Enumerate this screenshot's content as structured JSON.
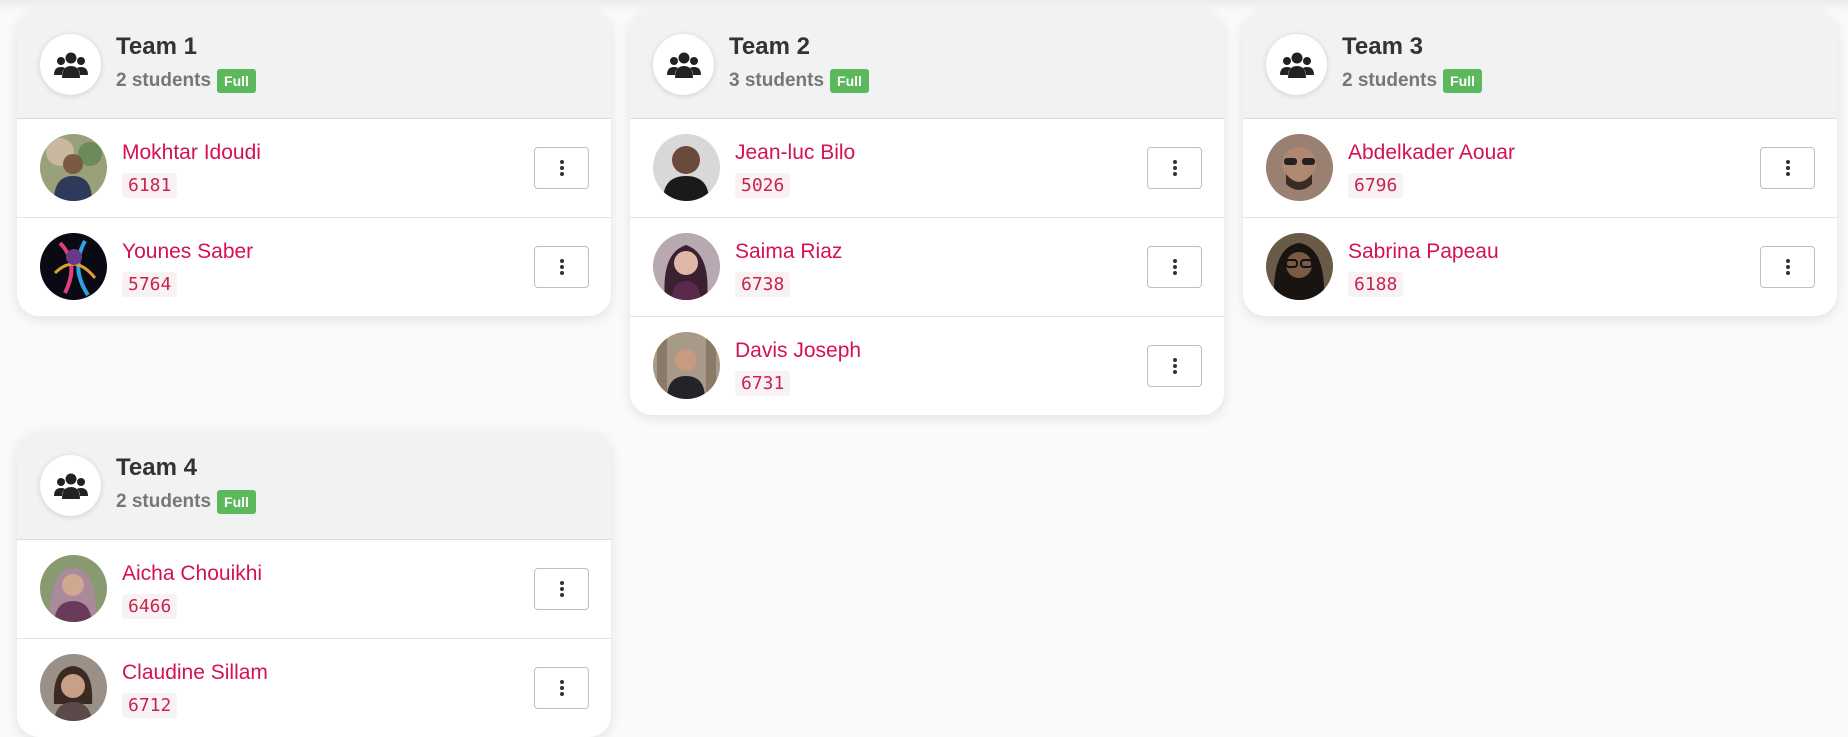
{
  "teams": [
    {
      "name": "Team 1",
      "count": "2 students",
      "badge": "Full",
      "members": [
        {
          "name": "Mokhtar Idoudi",
          "id": "6181",
          "avatar_color": "#8a7a5c"
        },
        {
          "name": "Younes Saber",
          "id": "5764",
          "avatar_color": "#2a1a3a"
        }
      ]
    },
    {
      "name": "Team 2",
      "count": "3 students",
      "badge": "Full",
      "members": [
        {
          "name": "Jean-luc Bilo",
          "id": "5026",
          "avatar_color": "#3a3a3a"
        },
        {
          "name": "Saima Riaz",
          "id": "6738",
          "avatar_color": "#6a4a5a"
        },
        {
          "name": "Davis Joseph",
          "id": "6731",
          "avatar_color": "#7a6a5a"
        }
      ]
    },
    {
      "name": "Team 3",
      "count": "2 students",
      "badge": "Full",
      "members": [
        {
          "name": "Abdelkader Aouar",
          "id": "6796",
          "avatar_color": "#6a4a3a"
        },
        {
          "name": "Sabrina Papeau",
          "id": "6188",
          "avatar_color": "#4a3a2a"
        }
      ]
    },
    {
      "name": "Team 4",
      "count": "2 students",
      "badge": "Full",
      "members": [
        {
          "name": "Aicha Chouikhi",
          "id": "6466",
          "avatar_color": "#8a6a7a"
        },
        {
          "name": "Claudine Sillam",
          "id": "6712",
          "avatar_color": "#7a6a6a"
        }
      ]
    }
  ],
  "icons": {
    "team": "users-icon",
    "menu": "more-vertical-icon"
  },
  "colors": {
    "member_name": "#d4124e",
    "badge": "#5cb85c",
    "header_bg": "#f1f2f2"
  }
}
